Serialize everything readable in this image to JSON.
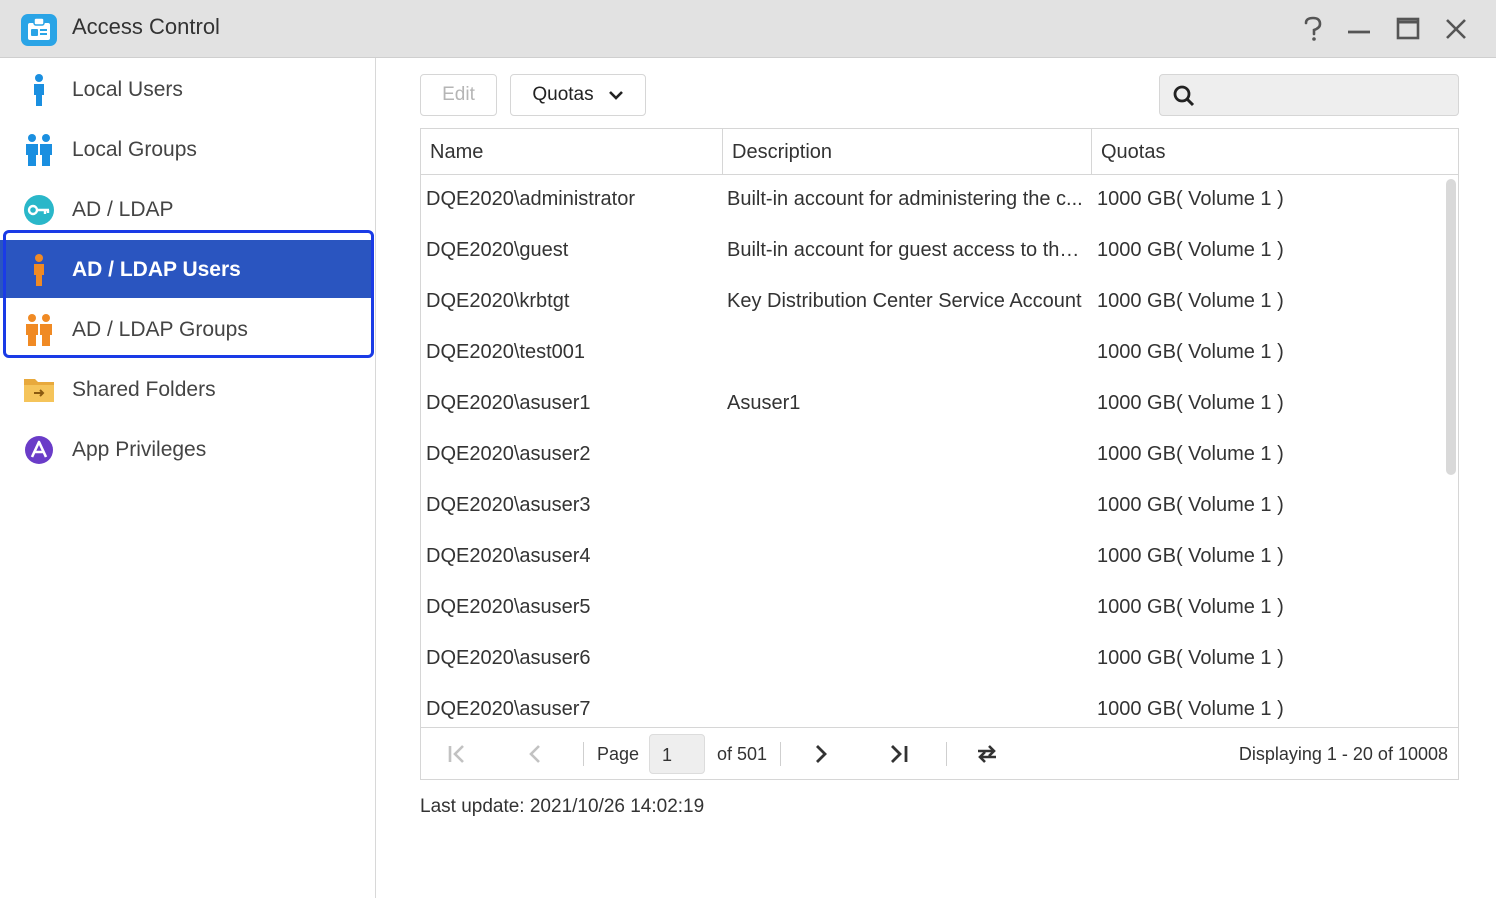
{
  "window": {
    "title": "Access Control"
  },
  "sidebar": {
    "items": [
      {
        "label": "Local Users",
        "icon": "local-user-icon"
      },
      {
        "label": "Local Groups",
        "icon": "local-group-icon"
      },
      {
        "label": "AD / LDAP",
        "icon": "key-icon"
      },
      {
        "label": "AD / LDAP Users",
        "icon": "ad-user-icon",
        "active": true
      },
      {
        "label": "AD / LDAP Groups",
        "icon": "ad-group-icon"
      },
      {
        "label": "Shared Folders",
        "icon": "folder-icon"
      },
      {
        "label": "App Privileges",
        "icon": "app-privileges-icon"
      }
    ]
  },
  "toolbar": {
    "edit_label": "Edit",
    "quotas_label": "Quotas",
    "search_value": ""
  },
  "table": {
    "columns": [
      "Name",
      "Description",
      "Quotas"
    ],
    "rows": [
      {
        "name": "DQE2020\\administrator",
        "description": "Built-in account for administering the c...",
        "quota": "1000 GB( Volume 1 )"
      },
      {
        "name": "DQE2020\\guest",
        "description": "Built-in account for guest access to the ...",
        "quota": "1000 GB( Volume 1 )"
      },
      {
        "name": "DQE2020\\krbtgt",
        "description": "Key Distribution Center Service Account",
        "quota": "1000 GB( Volume 1 )"
      },
      {
        "name": "DQE2020\\test001",
        "description": "",
        "quota": "1000 GB( Volume 1 )"
      },
      {
        "name": "DQE2020\\asuser1",
        "description": "Asuser1",
        "quota": "1000 GB( Volume 1 )"
      },
      {
        "name": "DQE2020\\asuser2",
        "description": "",
        "quota": "1000 GB( Volume 1 )"
      },
      {
        "name": "DQE2020\\asuser3",
        "description": "",
        "quota": "1000 GB( Volume 1 )"
      },
      {
        "name": "DQE2020\\asuser4",
        "description": "",
        "quota": "1000 GB( Volume 1 )"
      },
      {
        "name": "DQE2020\\asuser5",
        "description": "",
        "quota": "1000 GB( Volume 1 )"
      },
      {
        "name": "DQE2020\\asuser6",
        "description": "",
        "quota": "1000 GB( Volume 1 )"
      },
      {
        "name": "DQE2020\\asuser7",
        "description": "",
        "quota": "1000 GB( Volume 1 )"
      }
    ]
  },
  "pager": {
    "page_label": "Page",
    "page_value": "1",
    "of_label": "of 501",
    "displaying": "Displaying 1 - 20 of 10008"
  },
  "footer": {
    "last_update": "Last update: 2021/10/26 14:02:19"
  },
  "colors": {
    "active_bg": "#2a55c0",
    "highlight_border": "#1a3be6",
    "user_icon_blue": "#1a8fe0",
    "ad_icon_orange": "#f08a24"
  }
}
